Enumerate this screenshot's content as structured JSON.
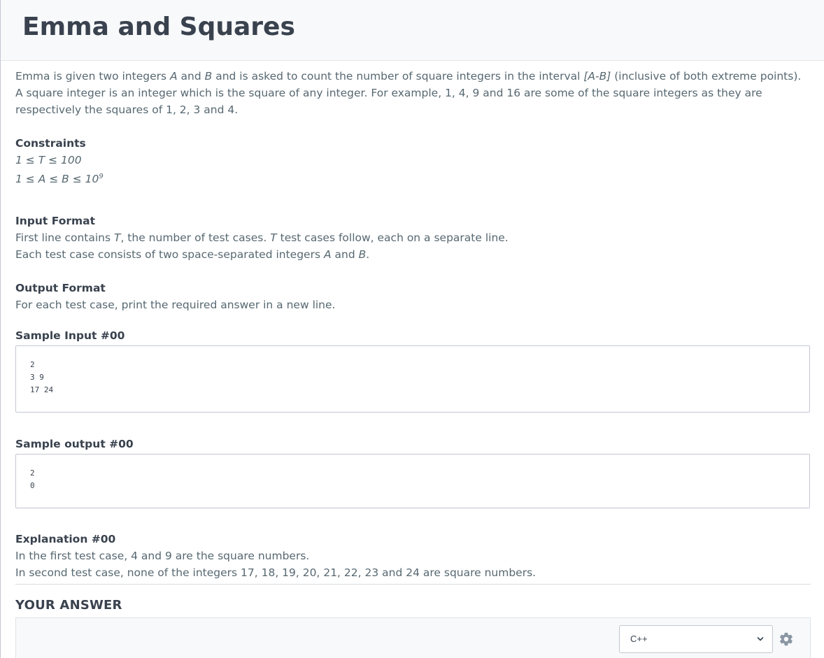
{
  "problem": {
    "title": "Emma and Squares",
    "intro": {
      "line1_a": "Emma is given two integers ",
      "var_A": "A",
      "line1_b": " and ",
      "var_B": "B",
      "line1_c": " and is asked to count the number of square integers in the interval ",
      "interval": "[A-B]",
      "line1_d": " (inclusive of both extreme points).",
      "line2": "A square integer is an integer which is the square of any integer. For example, 1, 4, 9 and 16 are some of the square integers as they are respectively the squares of 1, 2, 3 and 4."
    },
    "constraints": {
      "heading": "Constraints",
      "line1": "1 ≤ T ≤ 100",
      "line2": "1 ≤ A ≤ B ≤ 10",
      "line2_sup": "9"
    },
    "input_format": {
      "heading": "Input Format",
      "line1_a": "First line contains ",
      "var_T1": "T",
      "line1_b": ", the number of test cases. ",
      "var_T2": "T",
      "line1_c": " test cases follow, each on a separate line.",
      "line2_a": "Each test case consists of two space-separated integers ",
      "var_A": "A",
      "line2_b": " and ",
      "var_B": "B",
      "line2_c": "."
    },
    "output_format": {
      "heading": "Output Format",
      "line1": "For each test case, print the required answer in a new line."
    },
    "sample_input": {
      "heading": "Sample Input #00",
      "code": "2\n3 9\n17 24"
    },
    "sample_output": {
      "heading": "Sample output #00",
      "code": "2\n0"
    },
    "explanation": {
      "heading": "Explanation #00",
      "line1": "In the first test case, 4 and 9 are the square numbers.",
      "line2": "In second test case, none of the integers 17, 18, 19, 20, 21, 22, 23 and 24 are square numbers."
    }
  },
  "answer": {
    "heading": "YOUR ANSWER",
    "language": "C++",
    "icons": {
      "dropdown": "chevron-down-icon",
      "settings": "gear-icon"
    }
  }
}
